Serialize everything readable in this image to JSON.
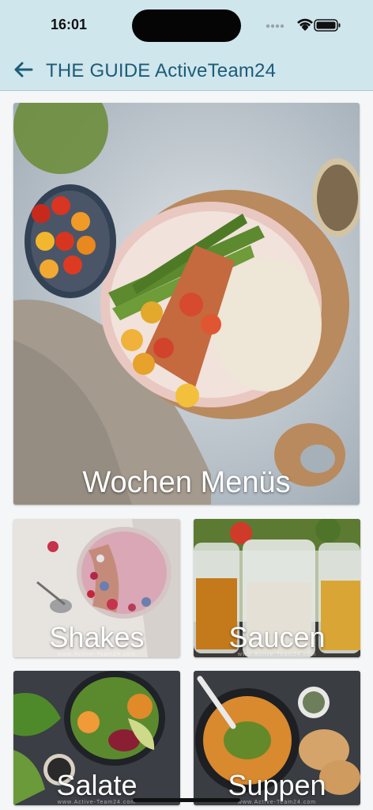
{
  "status_bar": {
    "time": "16:01"
  },
  "header": {
    "title": "THE GUIDE ActiveTeam24",
    "back_icon": "arrow-left-icon"
  },
  "tiles": [
    {
      "label": "Wochen Menüs"
    },
    {
      "label": "Shakes",
      "watermark": "www.Active-Team24.com"
    },
    {
      "label": "Saucen",
      "watermark": "www.Active-Team24.com"
    },
    {
      "label": "Salate",
      "watermark": "www.Active-Team24.com"
    },
    {
      "label": "Suppen",
      "watermark": "www.Active-Team24.com"
    }
  ],
  "colors": {
    "header_bg": "#cfe6ec",
    "title": "#1c5c78",
    "page_bg": "#f4f6f7"
  }
}
